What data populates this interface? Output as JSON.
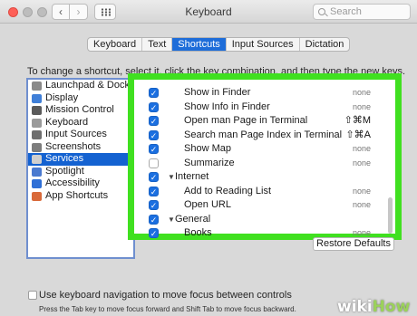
{
  "window": {
    "title": "Keyboard",
    "search_placeholder": "Search",
    "back_glyph": "‹",
    "forward_glyph": "›"
  },
  "tabs": [
    {
      "label": "Keyboard",
      "active": false
    },
    {
      "label": "Text",
      "active": false
    },
    {
      "label": "Shortcuts",
      "active": true
    },
    {
      "label": "Input Sources",
      "active": false
    },
    {
      "label": "Dictation",
      "active": false
    }
  ],
  "instructions": "To change a shortcut, select it, click the key combination, and then type the new keys.",
  "categories": [
    {
      "label": "Launchpad & Dock",
      "icon": "launchpad-icon",
      "color": "#8a8a8a"
    },
    {
      "label": "Display",
      "icon": "display-icon",
      "color": "#3f7fd8"
    },
    {
      "label": "Mission Control",
      "icon": "mission-control-icon",
      "color": "#5a5a5a"
    },
    {
      "label": "Keyboard",
      "icon": "keyboard-icon",
      "color": "#9a9a9a"
    },
    {
      "label": "Input Sources",
      "icon": "input-sources-icon",
      "color": "#6f6f6f"
    },
    {
      "label": "Screenshots",
      "icon": "screenshots-icon",
      "color": "#7d7d7d"
    },
    {
      "label": "Services",
      "icon": "gear-icon",
      "color": "#cfcfcf",
      "selected": true
    },
    {
      "label": "Spotlight",
      "icon": "spotlight-icon",
      "color": "#4a7ad0"
    },
    {
      "label": "Accessibility",
      "icon": "accessibility-icon",
      "color": "#2f6fd6"
    },
    {
      "label": "App Shortcuts",
      "icon": "app-shortcuts-icon",
      "color": "#d96a3a"
    }
  ],
  "shortcuts": [
    {
      "label": "Show in Finder",
      "checked": true,
      "shortcut": "none",
      "type": "item"
    },
    {
      "label": "Show Info in Finder",
      "checked": true,
      "shortcut": "none",
      "type": "item"
    },
    {
      "label": "Open man Page in Terminal",
      "checked": true,
      "shortcut": "⇧⌘M",
      "type": "item"
    },
    {
      "label": "Search man Page Index in Terminal",
      "checked": true,
      "shortcut": "⇧⌘A",
      "type": "item"
    },
    {
      "label": "Show Map",
      "checked": true,
      "shortcut": "none",
      "type": "item"
    },
    {
      "label": "Summarize",
      "checked": false,
      "shortcut": "none",
      "type": "item"
    },
    {
      "label": "Internet",
      "checked": true,
      "shortcut": "",
      "type": "group"
    },
    {
      "label": "Add to Reading List",
      "checked": true,
      "shortcut": "none",
      "type": "item"
    },
    {
      "label": "Open URL",
      "checked": true,
      "shortcut": "none",
      "type": "item"
    },
    {
      "label": "General",
      "checked": true,
      "shortcut": "",
      "type": "group"
    },
    {
      "label": "Books",
      "checked": true,
      "shortcut": "none",
      "type": "item"
    }
  ],
  "restore_defaults_label": "Restore Defaults",
  "keyboard_nav": {
    "label": "Use keyboard navigation to move focus between controls",
    "checked": false,
    "hint": "Press the Tab key to move focus forward and Shift Tab to move focus backward."
  },
  "watermark": {
    "wiki": "wiki",
    "how": "How"
  },
  "colors": {
    "highlight": "#40e020",
    "selection": "#1462d1",
    "accent": "#1e6dd9"
  }
}
